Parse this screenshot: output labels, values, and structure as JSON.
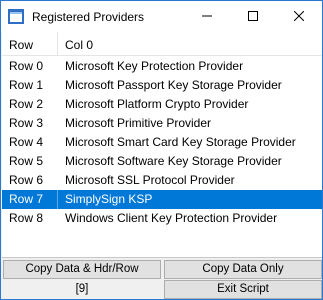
{
  "window": {
    "title": "Registered Providers"
  },
  "header": {
    "col0": "Row",
    "col1": "Col 0"
  },
  "rows": [
    {
      "row": "Row 0",
      "value": "Microsoft Key Protection Provider"
    },
    {
      "row": "Row 1",
      "value": "Microsoft Passport Key Storage Provider"
    },
    {
      "row": "Row 2",
      "value": "Microsoft Platform Crypto Provider"
    },
    {
      "row": "Row 3",
      "value": "Microsoft Primitive Provider"
    },
    {
      "row": "Row 4",
      "value": "Microsoft Smart Card Key Storage Provider"
    },
    {
      "row": "Row 5",
      "value": "Microsoft Software Key Storage Provider"
    },
    {
      "row": "Row 6",
      "value": "Microsoft SSL Protocol Provider"
    },
    {
      "row": "Row 7",
      "value": "SimplySign KSP"
    },
    {
      "row": "Row 8",
      "value": "Windows Client Key Protection Provider"
    }
  ],
  "selected_row": "Row 7",
  "buttons": {
    "copy_hdr": "Copy Data & Hdr/Row",
    "copy_data": "Copy Data Only",
    "exit": "Exit Script"
  },
  "status": "[9]",
  "colors": {
    "selection": "#0078d7",
    "icon_bg": "#2e6fc4"
  },
  "icons": {
    "app": "window-app-icon",
    "minimize": "minimize-icon",
    "maximize": "maximize-icon",
    "close": "close-icon"
  }
}
